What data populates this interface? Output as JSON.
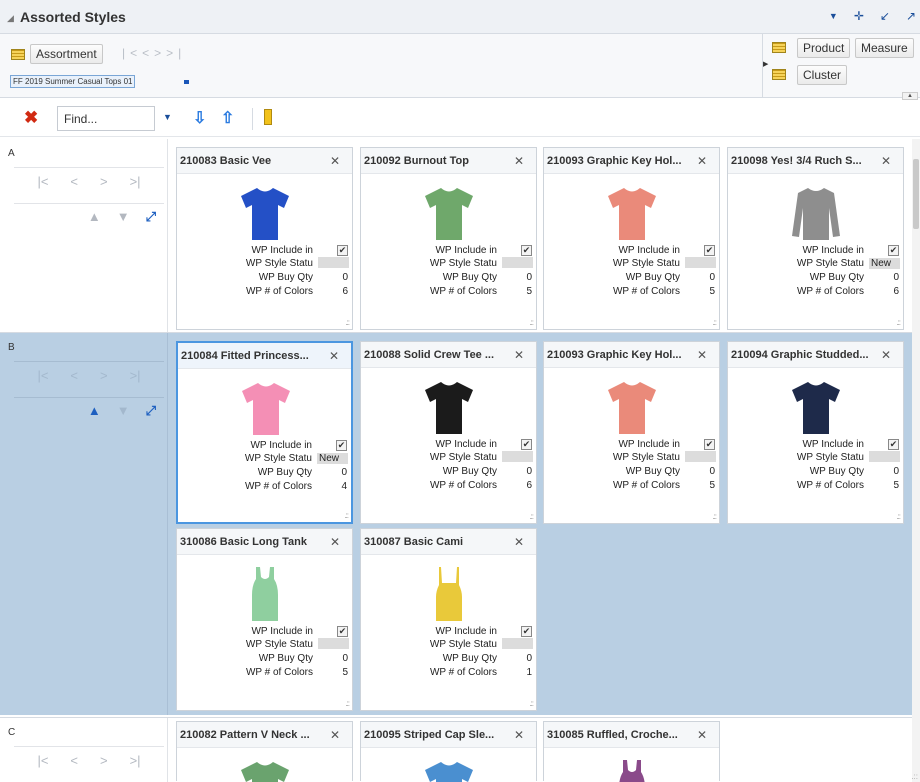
{
  "title": "Assorted Styles",
  "header": {
    "assortment_label": "Assortment",
    "current_assortment": "FF 2019 Summer Casual Tops 01",
    "product_label": "Product",
    "measure_label": "Measure",
    "cluster_label": "Cluster"
  },
  "toolbar": {
    "find_placeholder": "Find..."
  },
  "field_labels": {
    "include": "WP Include in",
    "status": "WP Style Statu",
    "buy_qty": "WP Buy Qty",
    "colors": "WP # of Colors"
  },
  "groups": [
    {
      "label": "A",
      "cards": [
        {
          "title": "210083 Basic Vee",
          "color": "#2450c6",
          "icon": "tshirt-icon",
          "include": true,
          "status": "",
          "buy_qty": "0",
          "colors": "6"
        },
        {
          "title": "210092 Burnout Top",
          "color": "#6fa86b",
          "icon": "tshirt-icon",
          "include": true,
          "status": "",
          "buy_qty": "0",
          "colors": "5"
        },
        {
          "title": "210093 Graphic Key Hol...",
          "color": "#ea8a7a",
          "icon": "tshirt-icon",
          "include": true,
          "status": "",
          "buy_qty": "0",
          "colors": "5"
        },
        {
          "title": "210098 Yes! 3/4 Ruch S...",
          "color": "#8e8e8e",
          "icon": "longsleeve-icon",
          "include": true,
          "status": "New",
          "buy_qty": "0",
          "colors": "6"
        }
      ]
    },
    {
      "label": "B",
      "cards": [
        {
          "title": "210084 Fitted Princess...",
          "color": "#f48fb5",
          "icon": "tshirt-icon",
          "include": true,
          "status": "New",
          "buy_qty": "0",
          "colors": "4"
        },
        {
          "title": "210088 Solid Crew Tee ...",
          "color": "#1b1b1b",
          "icon": "tshirt-icon",
          "include": true,
          "status": "",
          "buy_qty": "0",
          "colors": "6"
        },
        {
          "title": "210093 Graphic Key Hol...",
          "color": "#ea8a7a",
          "icon": "tshirt-icon",
          "include": true,
          "status": "",
          "buy_qty": "0",
          "colors": "5"
        },
        {
          "title": "210094 Graphic Studded...",
          "color": "#1e2a4a",
          "icon": "tshirt-icon",
          "include": true,
          "status": "",
          "buy_qty": "0",
          "colors": "5"
        },
        {
          "title": "310086 Basic Long Tank",
          "color": "#8fcf9f",
          "icon": "tank-icon",
          "include": true,
          "status": "",
          "buy_qty": "0",
          "colors": "5"
        },
        {
          "title": "310087 Basic Cami",
          "color": "#e9c93a",
          "icon": "cami-icon",
          "include": true,
          "status": "",
          "buy_qty": "0",
          "colors": "1"
        }
      ]
    },
    {
      "label": "C",
      "cards": [
        {
          "title": "210082 Pattern V Neck ...",
          "color": "#6aa36e",
          "icon": "tshirt-icon"
        },
        {
          "title": "210095 Striped Cap Sle...",
          "color": "#4a8fd0",
          "icon": "tshirt-icon"
        },
        {
          "title": "310085 Ruffled, Croche...",
          "color": "#8a4a8a",
          "icon": "tank-icon"
        }
      ]
    }
  ]
}
